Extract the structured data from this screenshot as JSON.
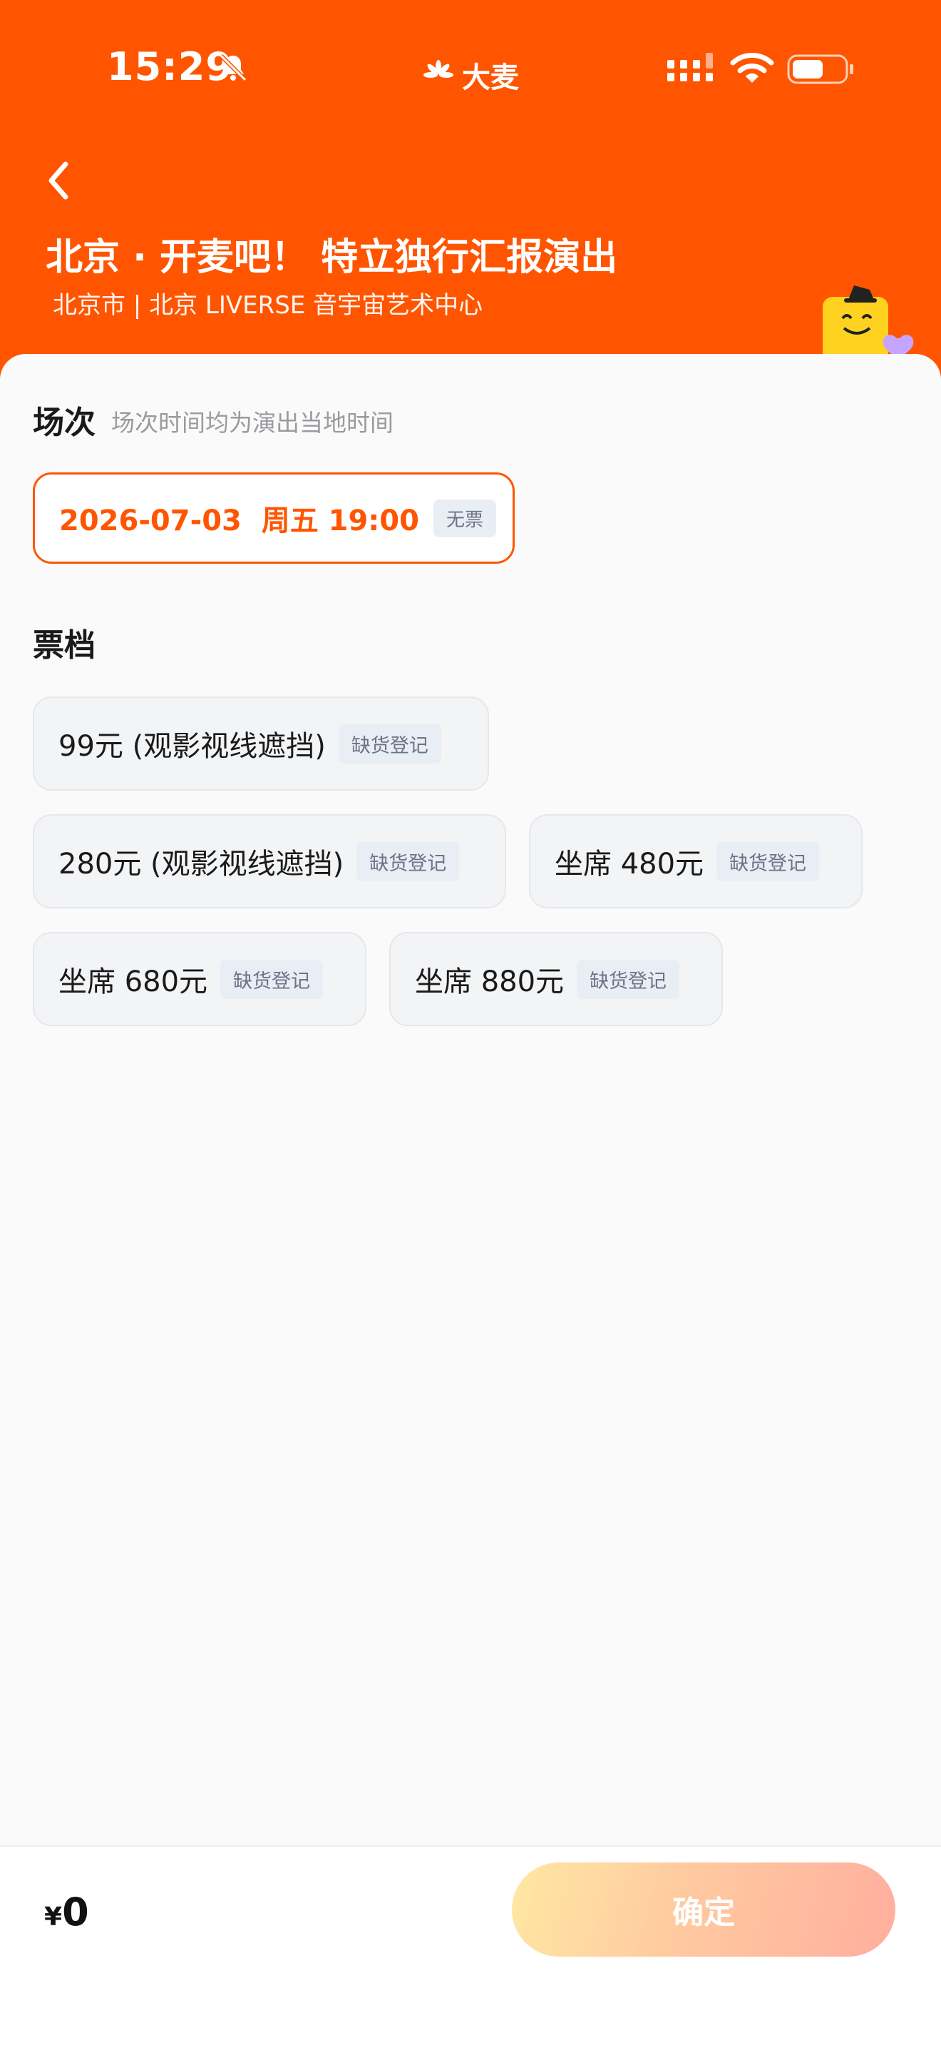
{
  "status_bar": {
    "time": "15:29",
    "brand": "大麦"
  },
  "header": {
    "title": "北京 · 开麦吧！ 特立独行汇报演出",
    "subtitle": "北京市 | 北京 LIVERSE 音宇宙艺术中心"
  },
  "session": {
    "heading": "场次",
    "hint": "场次时间均为演出当地时间",
    "options": [
      {
        "label": "2026-07-03  周五 19:00",
        "badge": "无票",
        "selected": true
      }
    ]
  },
  "tiers": {
    "heading": "票档",
    "items": [
      {
        "label": "99元 (观影视线遮挡)",
        "badge": "缺货登记"
      },
      {
        "label": "280元 (观影视线遮挡)",
        "badge": "缺货登记"
      },
      {
        "label": "坐席 480元",
        "badge": "缺货登记"
      },
      {
        "label": "坐席 680元",
        "badge": "缺货登记"
      },
      {
        "label": "坐席 880元",
        "badge": "缺货登记"
      }
    ]
  },
  "footer": {
    "currency": "¥",
    "price": "0",
    "confirm_label": "确定"
  },
  "colors": {
    "brand_orange": "#ff5500",
    "badge_bg": "#e9edf4",
    "badge_text": "#6b7487"
  },
  "icons": [
    "bell-slash-icon",
    "damai-logo-icon",
    "signal-icon",
    "wifi-icon",
    "battery-icon",
    "back-arrow-icon",
    "mascot-icon"
  ]
}
